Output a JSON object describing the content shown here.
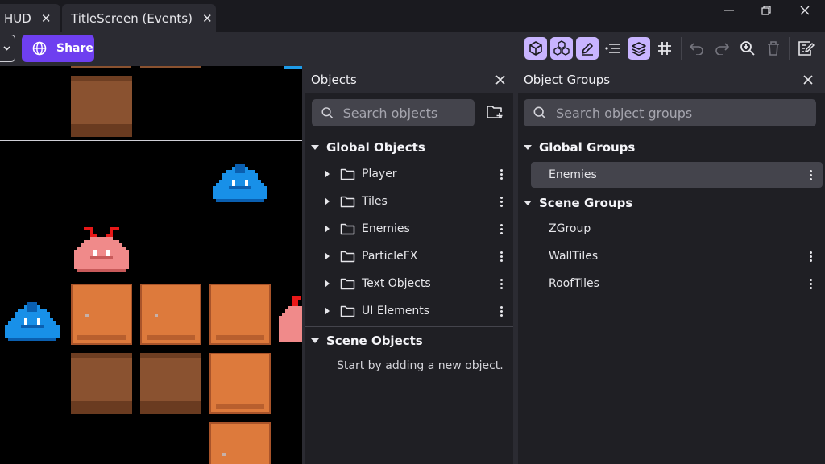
{
  "tabs": [
    {
      "label": "HUD"
    },
    {
      "label": "TitleScreen (Events)"
    }
  ],
  "toolbar": {
    "share_label": "Share",
    "icons": [
      "object-3d-icon",
      "instances-icon",
      "edit-icon",
      "list-icon",
      "layers-icon",
      "grid-icon",
      "undo-icon",
      "redo-icon",
      "zoom-icon",
      "trash-icon",
      "edit-events-icon"
    ]
  },
  "objects_panel": {
    "title": "Objects",
    "search_placeholder": "Search objects",
    "global_section": "Global Objects",
    "folders": [
      {
        "label": "Player"
      },
      {
        "label": "Tiles"
      },
      {
        "label": "Enemies"
      },
      {
        "label": "ParticleFX"
      },
      {
        "label": "Text Objects"
      },
      {
        "label": "UI Elements"
      }
    ],
    "scene_section": "Scene Objects",
    "empty_message": "Start by adding a new object."
  },
  "groups_panel": {
    "title": "Object Groups",
    "search_placeholder": "Search object groups",
    "global_section": "Global Groups",
    "global_groups": [
      {
        "label": "Enemies"
      }
    ],
    "scene_section": "Scene Groups",
    "scene_groups": [
      {
        "label": "ZGroup"
      },
      {
        "label": "WallTiles"
      },
      {
        "label": "RoofTiles"
      }
    ]
  },
  "colors": {
    "accent": "#6e3ff0",
    "active_tool": "#c8b4ff",
    "panel_bg": "#2b2b32",
    "body_bg": "#1f1f24"
  }
}
